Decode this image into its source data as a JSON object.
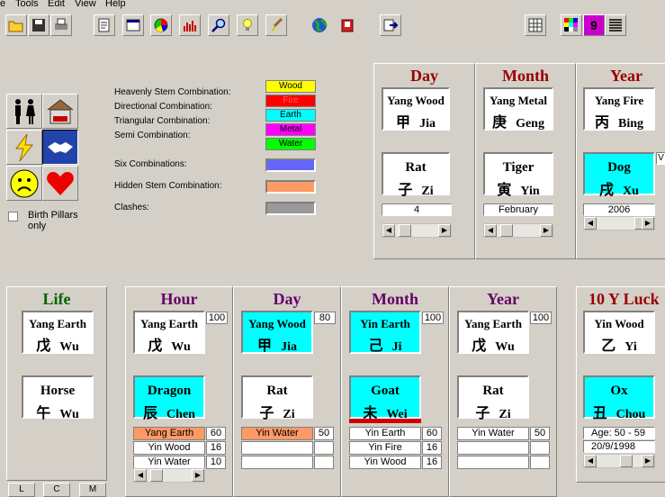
{
  "menu": [
    "e",
    "Tools",
    "Edit",
    "View",
    "Help"
  ],
  "legend": {
    "heavenly": "Heavenly Stem Combination:",
    "directional": "Directional Combination:",
    "triangular": "Triangular Combination:",
    "semi": "Semi Combination:",
    "six": "Six Combinations:",
    "hidden": "Hidden Stem Combination:",
    "clashes": "Clashes:",
    "swatches": [
      {
        "label": "Wood",
        "color": "#ffff00",
        "text": "#000000"
      },
      {
        "label": "Fire",
        "color": "#ff0000",
        "text": "#ff6666"
      },
      {
        "label": "Earth",
        "color": "#00ffff",
        "text": "#000000"
      },
      {
        "label": "Metal",
        "color": "#ff00ff",
        "text": "#000000"
      },
      {
        "label": "Water",
        "color": "#00ff00",
        "text": "#000000"
      }
    ],
    "six_color": "#6666ff",
    "hidden_color": "#ff9966",
    "clash_color": "#999999"
  },
  "birth_pillars_only": "Birth Pillars only",
  "top": {
    "day": {
      "title": "Day",
      "stem_en": "Yang Wood",
      "stem_cn": "甲",
      "stem_py": "Jia",
      "branch_en": "Rat",
      "branch_cn": "子",
      "branch_py": "Zi",
      "value": "4"
    },
    "month": {
      "title": "Month",
      "stem_en": "Yang Metal",
      "stem_cn": "庚",
      "stem_py": "Geng",
      "branch_en": "Tiger",
      "branch_cn": "寅",
      "branch_py": "Yin",
      "value": "February"
    },
    "year": {
      "title": "Year",
      "stem_en": "Yang Fire",
      "stem_cn": "丙",
      "stem_py": "Bing",
      "branch_en": "Dog",
      "branch_cn": "戌",
      "branch_py": "Xu",
      "value": "2006",
      "side": "V"
    }
  },
  "life": {
    "title": "Life",
    "stem_en": "Yang Earth",
    "stem_cn": "戊",
    "stem_py": "Wu",
    "branch_en": "Horse",
    "branch_cn": "午",
    "branch_py": "Wu"
  },
  "hour": {
    "title": "Hour",
    "stem_en": "Yang Earth",
    "stem_cn": "戊",
    "stem_py": "Wu",
    "num": "100",
    "branch_en": "Dragon",
    "branch_cn": "辰",
    "branch_py": "Chen",
    "hidden": [
      {
        "name": "Yang Earth",
        "val": "60"
      },
      {
        "name": "Yin Wood",
        "val": "16"
      },
      {
        "name": "Yin Water",
        "val": "10"
      }
    ]
  },
  "day": {
    "title": "Day",
    "stem_en": "Yang Wood",
    "stem_cn": "甲",
    "stem_py": "Jia",
    "num": "80",
    "branch_en": "Rat",
    "branch_cn": "子",
    "branch_py": "Zi",
    "hidden": [
      {
        "name": "Yin Water",
        "val": "50"
      }
    ]
  },
  "month": {
    "title": "Month",
    "stem_en": "Yin Earth",
    "stem_cn": "己",
    "stem_py": "Ji",
    "num": "100",
    "branch_en": "Goat",
    "branch_cn": "未",
    "branch_py": "Wei",
    "hidden": [
      {
        "name": "Yin Earth",
        "val": "60"
      },
      {
        "name": "Yin Fire",
        "val": "16"
      },
      {
        "name": "Yin Wood",
        "val": "16"
      }
    ]
  },
  "year": {
    "title": "Year",
    "stem_en": "Yang Earth",
    "stem_cn": "戊",
    "stem_py": "Wu",
    "num": "100",
    "branch_en": "Rat",
    "branch_cn": "子",
    "branch_py": "Zi",
    "hidden": [
      {
        "name": "Yin Water",
        "val": "50"
      }
    ]
  },
  "luck": {
    "title": "10 Y Luck",
    "stem_en": "Yin Wood",
    "stem_cn": "乙",
    "stem_py": "Yi",
    "branch_en": "Ox",
    "branch_cn": "丑",
    "branch_py": "Chou",
    "age": "Age: 50 - 59",
    "date": "20/9/1998"
  },
  "buttons": {
    "l": "L",
    "c": "C",
    "m": "M"
  },
  "nine": "9",
  "colors": {
    "title": "#990000",
    "title2": "#660066",
    "green": "#006600",
    "cyan": "#00ffff",
    "orange": "#ff9966"
  }
}
